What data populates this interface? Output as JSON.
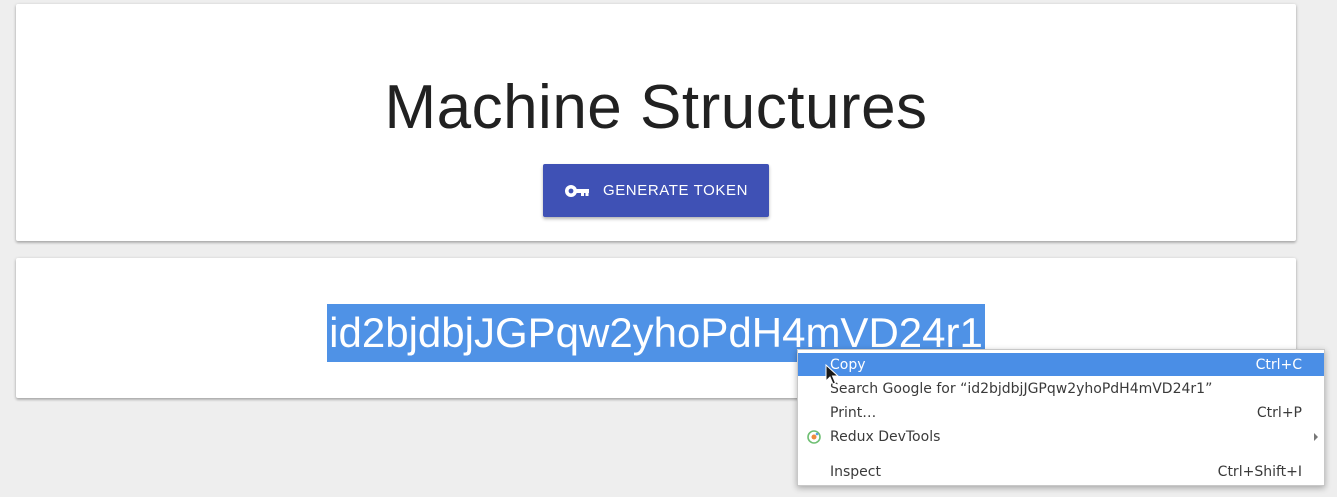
{
  "header": {
    "title": "Machine Structures",
    "generate_button_label": "GENERATE TOKEN",
    "generate_button_icon": "key-icon",
    "accent_color": "#3f51b5"
  },
  "token": {
    "value": "id2bjdbjJGPqw2yhoPdH4mVD24r1",
    "selection_color": "#4f92e6"
  },
  "context_menu": {
    "items": [
      {
        "label": "Copy",
        "shortcut": "Ctrl+C"
      },
      {
        "label": "Search Google for “id2bjdbjJGPqw2yhoPdH4mVD24r1”",
        "shortcut": ""
      },
      {
        "label": "Print…",
        "shortcut": "Ctrl+P"
      },
      {
        "label": "Redux DevTools",
        "shortcut": "",
        "icon": "redux-icon",
        "submenu": true
      },
      {
        "label": "Inspect",
        "shortcut": "Ctrl+Shift+I"
      }
    ]
  }
}
